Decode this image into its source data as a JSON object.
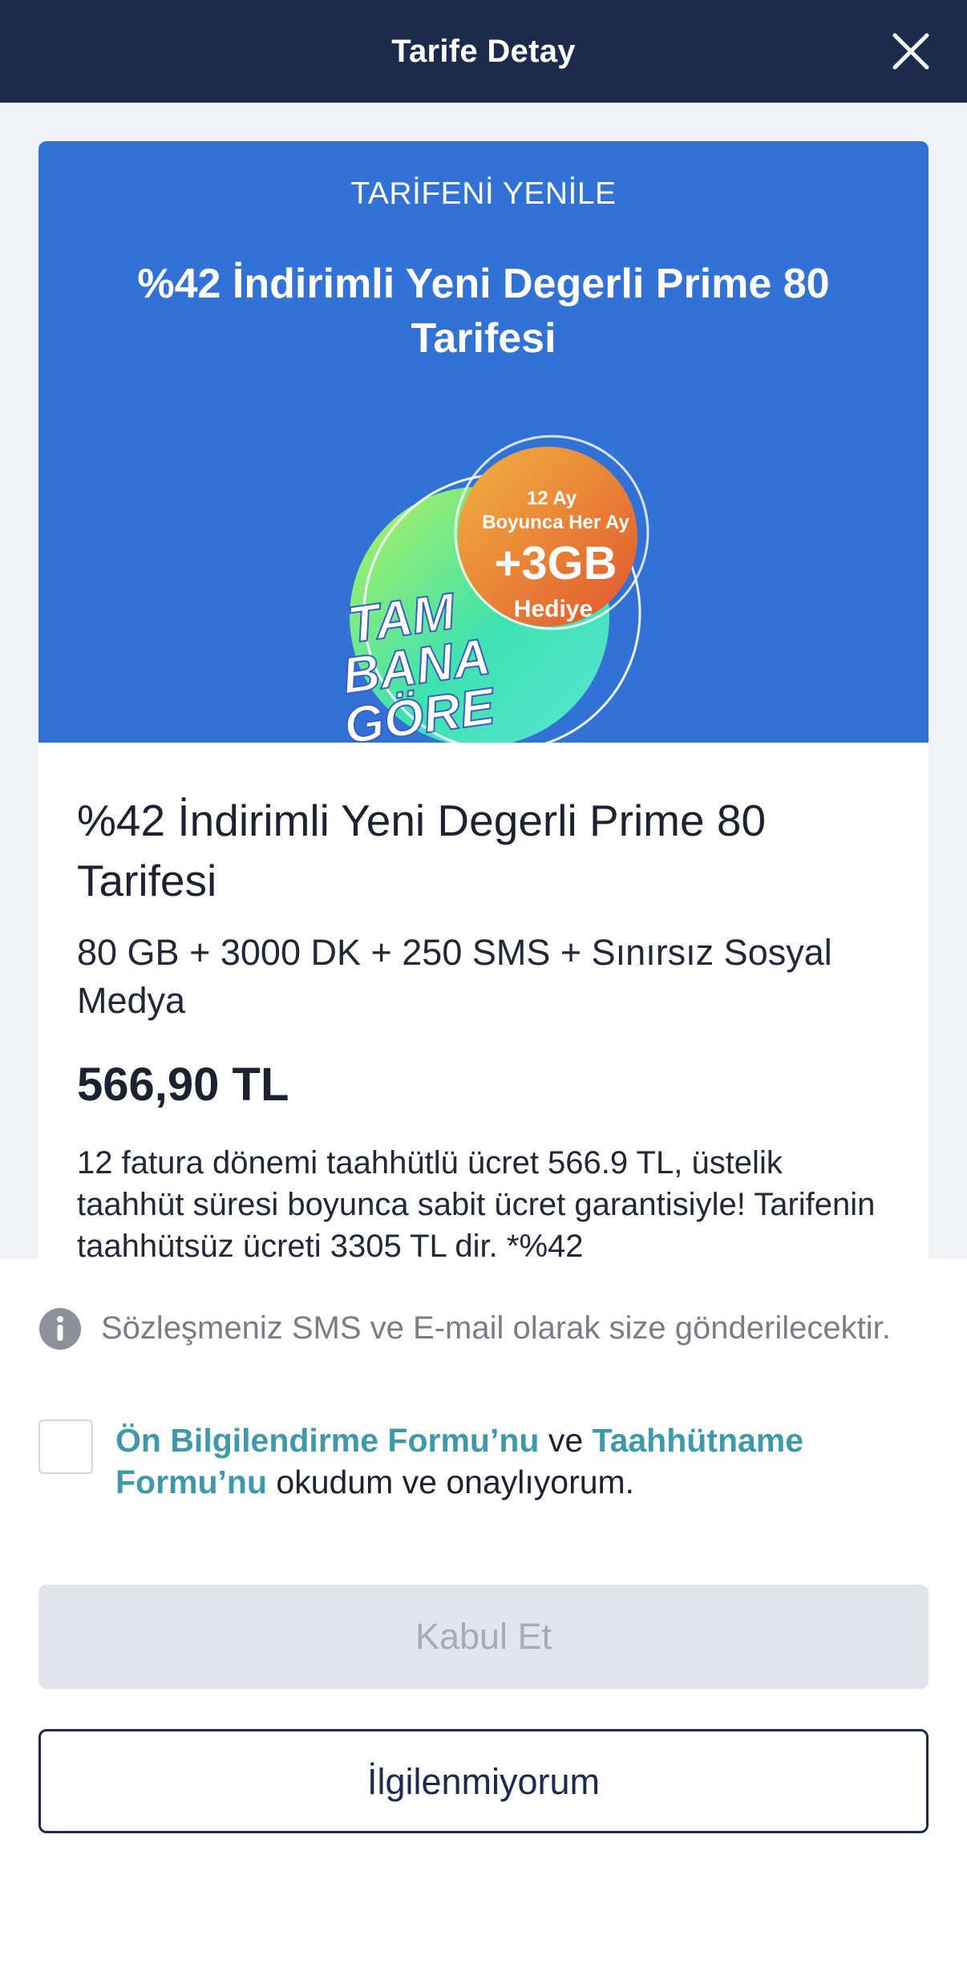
{
  "header": {
    "title": "Tarife Detay",
    "close_icon": "close-icon"
  },
  "banner": {
    "kicker": "TARİFENİ YENİLE",
    "title": "%42 İndirimli Yeni Degerli Prime 80 Tarifesi",
    "promo": {
      "line1": "12 Ay",
      "line2": "Boyunca Her Ay",
      "line3": "+3GB",
      "line4": "Hediye",
      "logo_line1": "TAM",
      "logo_line2": "BANA",
      "logo_line3": "GÖRE"
    }
  },
  "plan": {
    "name": "%42 İndirimli Yeni Degerli Prime 80 Tarifesi",
    "features": "80 GB + 3000 DK + 250 SMS + Sınırsız Sosyal Medya",
    "price": "566,90 TL",
    "description": "12 fatura dönemi taahhütlü ücret 566.9 TL, üstelik taahhüt süresi boyunca sabit ücret garantisiyle!",
    "description_cut": "Tarifenin taahhütsüz ücreti 3305 TL dir. *%42"
  },
  "sheet": {
    "info_icon": "info-icon",
    "info_text": "Sözleşmeniz SMS ve E-mail olarak size gönderilecektir.",
    "consent": {
      "link1": "Ön Bilgilendirme Formu’nu",
      "connector": " ve ",
      "link2": "Taahhütname Formu’nu",
      "suffix": " okudum ve onaylıyorum."
    },
    "accept_label": "Kabul Et",
    "decline_label": "İlgilenmiyorum"
  },
  "colors": {
    "header_bg": "#1c2a4c",
    "banner_bg": "#3272d6",
    "link": "#3e9aa8",
    "accept_disabled_bg": "#e4e5ea"
  }
}
